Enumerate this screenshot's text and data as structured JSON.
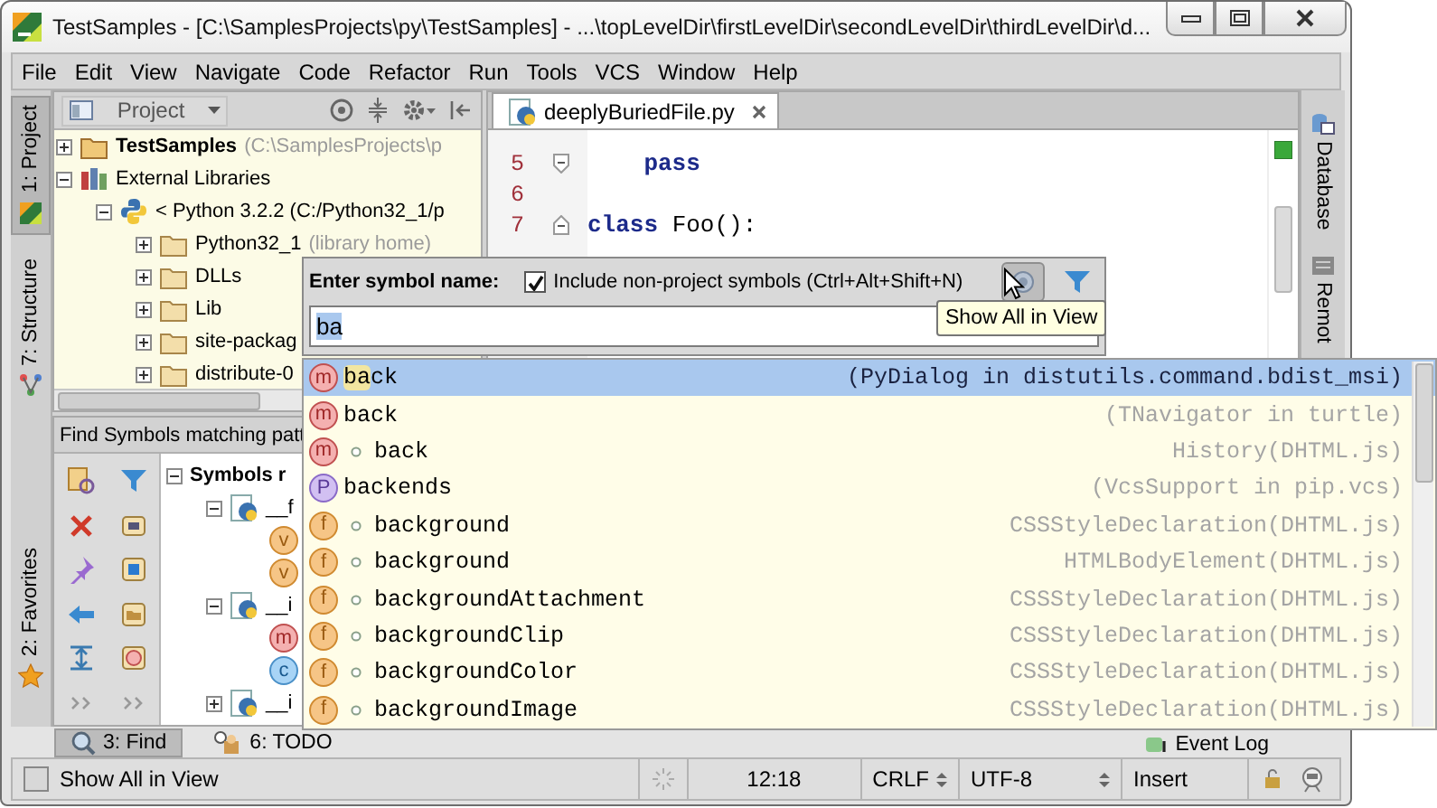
{
  "window": {
    "title": "TestSamples - [C:\\SamplesProjects\\py\\TestSamples] - ...\\topLevelDir\\firstLevelDir\\secondLevelDir\\thirdLevelDir\\d..."
  },
  "menu": [
    "File",
    "Edit",
    "View",
    "Navigate",
    "Code",
    "Refactor",
    "Run",
    "Tools",
    "VCS",
    "Window",
    "Help"
  ],
  "left_tool_windows": {
    "top": [
      {
        "label": "1: Project",
        "selected": true
      },
      {
        "label": "7: Structure",
        "selected": false
      }
    ],
    "bottom": [
      {
        "label": "2: Favorites",
        "selected": false
      }
    ]
  },
  "right_tool_windows": [
    {
      "label": "Database"
    },
    {
      "label": "Remot"
    }
  ],
  "project_panel": {
    "title": "Project",
    "tree": [
      {
        "label": "TestSamples",
        "note": "(C:\\SamplesProjects\\p",
        "kind": "project",
        "expanded": false
      },
      {
        "label": "External Libraries",
        "kind": "library",
        "expanded": true,
        "children": [
          {
            "label": "< Python 3.2.2 (C:/Python32_1/p",
            "kind": "python",
            "expanded": true,
            "children": [
              {
                "label": "Python32_1",
                "note": "(library home)",
                "kind": "folder",
                "expanded": false
              },
              {
                "label": "DLLs",
                "kind": "folder",
                "expanded": false
              },
              {
                "label": "Lib",
                "kind": "folder",
                "expanded": false
              },
              {
                "label": "site-packag",
                "kind": "folder",
                "expanded": false
              },
              {
                "label": "distribute-0",
                "kind": "folder",
                "expanded": false
              }
            ]
          }
        ]
      }
    ]
  },
  "editor": {
    "tab": "deeplyBuriedFile.py",
    "lines": [
      {
        "number": "5",
        "kind": "close",
        "code": [
          {
            "text": "    pass",
            "kind": "keyword"
          }
        ]
      },
      {
        "number": "6"
      },
      {
        "number": "7",
        "kind": "open",
        "code": [
          {
            "text": "class",
            "kind": "keyword"
          },
          {
            "text": " Foo():"
          }
        ]
      }
    ]
  },
  "find_panel": {
    "title": "Find Symbols matching patt",
    "tree": [
      {
        "label": "Symbols r",
        "kind": "group",
        "expanded": true,
        "children": [
          {
            "label": "__f",
            "kind": "python",
            "expanded": true,
            "children": [
              {
                "badge": "v",
                "kind": "variable"
              },
              {
                "badge": "v",
                "kind": "variable"
              }
            ]
          },
          {
            "label": "__i",
            "kind": "python",
            "expanded": true,
            "children": [
              {
                "badge": "m",
                "kind": "method"
              },
              {
                "badge": "c",
                "kind": "class"
              }
            ]
          },
          {
            "label": "__i",
            "kind": "python",
            "expanded": false
          }
        ]
      }
    ]
  },
  "bottom_tool_windows": [
    {
      "label": "3: Find",
      "selected": true
    },
    {
      "label": "6: TODO",
      "selected": false
    }
  ],
  "event_log": "Event Log",
  "status_bar": {
    "message": "Show All in View",
    "caret_position": "12:18",
    "line_separator": "CRLF",
    "encoding": "UTF-8",
    "insert_mode": "Insert"
  },
  "symbol_popup": {
    "prompt": "Enter symbol name:",
    "include_non_project": {
      "label": "Include non-project symbols (Ctrl+Alt+Shift+N)",
      "checked": true
    },
    "show_all_in_view": {
      "selected": true
    },
    "query": "ba",
    "tooltip": "Show All in View",
    "results": [
      {
        "badge": "m",
        "kind": "method",
        "marker": false,
        "name": "back",
        "location": "(PyDialog in distutils.command.bdist_msi)",
        "selected": true
      },
      {
        "badge": "m",
        "kind": "method",
        "marker": false,
        "name": "back",
        "location": "(TNavigator in turtle)",
        "selected": false
      },
      {
        "badge": "m",
        "kind": "method",
        "marker": true,
        "name": "back",
        "location": "History(DHTML.js)",
        "selected": false
      },
      {
        "badge": "P",
        "kind": "property",
        "marker": false,
        "name": "backends",
        "location": "(VcsSupport in pip.vcs)",
        "selected": false
      },
      {
        "badge": "f",
        "kind": "field",
        "marker": true,
        "name": "background",
        "location": "CSSStyleDeclaration(DHTML.js)",
        "selected": false
      },
      {
        "badge": "f",
        "kind": "field",
        "marker": true,
        "name": "background",
        "location": "HTMLBodyElement(DHTML.js)",
        "selected": false
      },
      {
        "badge": "f",
        "kind": "field",
        "marker": true,
        "name": "backgroundAttachment",
        "location": "CSSStyleDeclaration(DHTML.js)",
        "selected": false
      },
      {
        "badge": "f",
        "kind": "field",
        "marker": true,
        "name": "backgroundClip",
        "location": "CSSStyleDeclaration(DHTML.js)",
        "selected": false
      },
      {
        "badge": "f",
        "kind": "field",
        "marker": true,
        "name": "backgroundColor",
        "location": "CSSStyleDeclaration(DHTML.js)",
        "selected": false
      },
      {
        "badge": "f",
        "kind": "field",
        "marker": true,
        "name": "backgroundImage",
        "location": "CSSStyleDeclaration(DHTML.js)",
        "selected": false
      }
    ]
  }
}
